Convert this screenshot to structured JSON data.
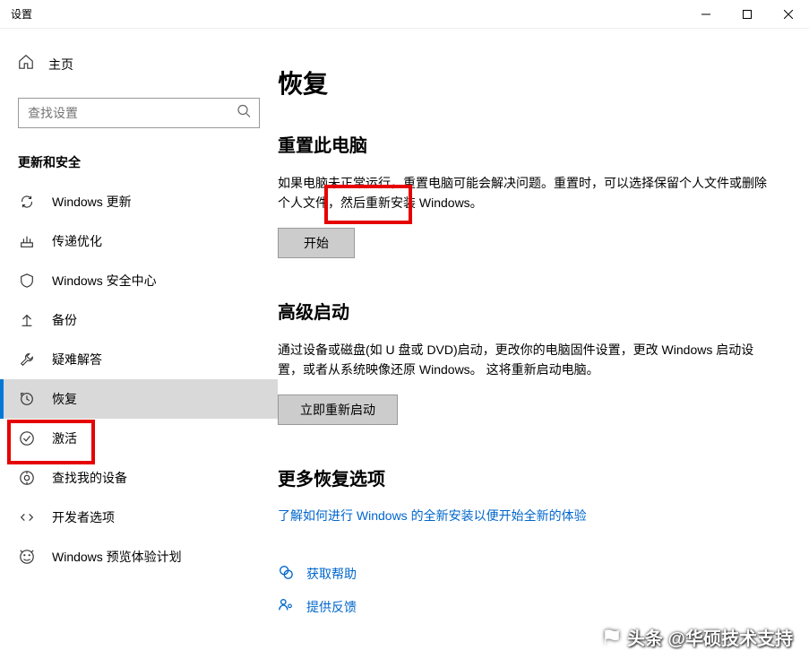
{
  "titlebar": {
    "text": "设置"
  },
  "sidebar": {
    "home": "主页",
    "search_placeholder": "查找设置",
    "section_header": "更新和安全",
    "items": [
      {
        "label": "Windows 更新"
      },
      {
        "label": "传递优化"
      },
      {
        "label": "Windows 安全中心"
      },
      {
        "label": "备份"
      },
      {
        "label": "疑难解答"
      },
      {
        "label": "恢复"
      },
      {
        "label": "激活"
      },
      {
        "label": "查找我的设备"
      },
      {
        "label": "开发者选项"
      },
      {
        "label": "Windows 预览体验计划"
      }
    ]
  },
  "main": {
    "title": "恢复",
    "reset": {
      "title": "重置此电脑",
      "desc": "如果电脑未正常运行，重置电脑可能会解决问题。重置时，可以选择保留个人文件或删除个人文件，然后重新安装 Windows。",
      "button": "开始"
    },
    "advanced": {
      "title": "高级启动",
      "desc": "通过设备或磁盘(如 U 盘或 DVD)启动，更改你的电脑固件设置，更改 Windows 启动设置，或者从系统映像还原 Windows。 这将重新启动电脑。",
      "button": "立即重新启动"
    },
    "more": {
      "title": "更多恢复选项",
      "link": "了解如何进行 Windows 的全新安装以便开始全新的体验"
    },
    "help": "获取帮助",
    "feedback": "提供反馈"
  },
  "watermark": "头条 @华硕技术支持"
}
